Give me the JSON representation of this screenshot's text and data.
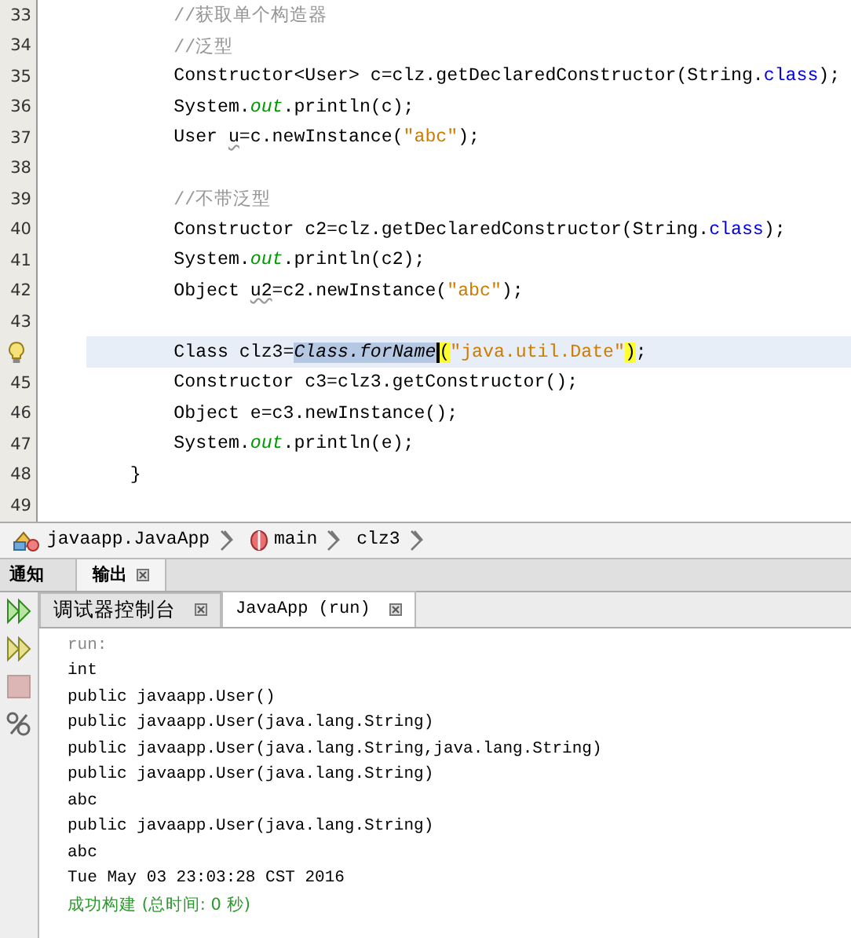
{
  "editor": {
    "lines": [
      {
        "number": "33",
        "tokens": [
          {
            "kind": "comment",
            "text": "        //获取单个构造器"
          }
        ]
      },
      {
        "number": "34",
        "tokens": [
          {
            "kind": "comment",
            "text": "        //泛型"
          }
        ]
      },
      {
        "number": "35",
        "tokens": [
          {
            "kind": "plain",
            "text": "        Constructor<User> c=clz.getDeclaredConstructor(String."
          },
          {
            "kind": "keyword",
            "text": "class"
          },
          {
            "kind": "plain",
            "text": ");"
          }
        ]
      },
      {
        "number": "36",
        "tokens": [
          {
            "kind": "plain",
            "text": "        System."
          },
          {
            "kind": "field",
            "text": "out"
          },
          {
            "kind": "plain",
            "text": ".println(c);"
          }
        ]
      },
      {
        "number": "37",
        "tokens": [
          {
            "kind": "plain",
            "text": "        User "
          },
          {
            "kind": "warning",
            "text": "u"
          },
          {
            "kind": "plain",
            "text": "=c.newInstance("
          },
          {
            "kind": "string",
            "text": "\"abc\""
          },
          {
            "kind": "plain",
            "text": ");"
          }
        ]
      },
      {
        "number": "38"
      },
      {
        "number": "39",
        "tokens": [
          {
            "kind": "comment",
            "text": "        //不带泛型"
          }
        ]
      },
      {
        "number": "40",
        "tokens": [
          {
            "kind": "plain",
            "text": "        Constructor c2=clz.getDeclaredConstructor(String."
          },
          {
            "kind": "keyword",
            "text": "class"
          },
          {
            "kind": "plain",
            "text": ");"
          }
        ]
      },
      {
        "number": "41",
        "tokens": [
          {
            "kind": "plain",
            "text": "        System."
          },
          {
            "kind": "field",
            "text": "out"
          },
          {
            "kind": "plain",
            "text": ".println(c2);"
          }
        ]
      },
      {
        "number": "42",
        "tokens": [
          {
            "kind": "plain",
            "text": "        Object "
          },
          {
            "kind": "warning",
            "text": "u2"
          },
          {
            "kind": "plain",
            "text": "=c2.newInstance("
          },
          {
            "kind": "string",
            "text": "\"abc\""
          },
          {
            "kind": "plain",
            "text": ");"
          }
        ]
      },
      {
        "number": "43"
      },
      {
        "hint": true,
        "current": true,
        "tokens": [
          {
            "kind": "plain",
            "text": "        Class clz3="
          },
          {
            "kind": "selection",
            "text": "Class.forName",
            "caret": true
          },
          {
            "kind": "bracket",
            "text": "("
          },
          {
            "kind": "string",
            "text": "\"java.util.Date\""
          },
          {
            "kind": "bracket",
            "text": ")"
          },
          {
            "kind": "plain",
            "text": ";"
          }
        ]
      },
      {
        "number": "45",
        "tokens": [
          {
            "kind": "plain",
            "text": "        Constructor c3=clz3.getConstructor();"
          }
        ]
      },
      {
        "number": "46",
        "tokens": [
          {
            "kind": "plain",
            "text": "        Object e=c3.newInstance();"
          }
        ]
      },
      {
        "number": "47",
        "tokens": [
          {
            "kind": "plain",
            "text": "        System."
          },
          {
            "kind": "field",
            "text": "out"
          },
          {
            "kind": "plain",
            "text": ".println(e);"
          }
        ]
      },
      {
        "number": "48",
        "tokens": [
          {
            "kind": "plain",
            "text": "    }"
          }
        ]
      },
      {
        "number": "49"
      }
    ]
  },
  "breadcrumb": [
    {
      "kind": "class",
      "label": "javaapp.JavaApp"
    },
    {
      "kind": "method",
      "label": "main"
    },
    {
      "kind": "variable",
      "label": "clz3"
    }
  ],
  "panel_tabs": [
    {
      "label": "通知",
      "selected": false,
      "closable": false
    },
    {
      "label": "输出",
      "selected": true,
      "closable": true
    }
  ],
  "output_tabs": [
    {
      "label": "调试器控制台",
      "selected": false,
      "closable": true
    },
    {
      "label": "JavaApp (run)",
      "selected": true,
      "closable": true
    }
  ],
  "toolbar": [
    {
      "kind": "rerun",
      "disabled": false
    },
    {
      "kind": "rerun-last",
      "disabled": false
    },
    {
      "kind": "stop",
      "disabled": true
    },
    {
      "kind": "settings",
      "disabled": false
    }
  ],
  "output": [
    {
      "kind": "muted",
      "text": "run:"
    },
    {
      "kind": "normal",
      "text": "int"
    },
    {
      "kind": "normal",
      "text": "public javaapp.User()"
    },
    {
      "kind": "normal",
      "text": "public javaapp.User(java.lang.String)"
    },
    {
      "kind": "normal",
      "text": "public javaapp.User(java.lang.String,java.lang.String)"
    },
    {
      "kind": "normal",
      "text": "public javaapp.User(java.lang.String)"
    },
    {
      "kind": "normal",
      "text": "abc"
    },
    {
      "kind": "normal",
      "text": "public javaapp.User(java.lang.String)"
    },
    {
      "kind": "normal",
      "text": "abc"
    },
    {
      "kind": "normal",
      "text": "Tue May 03 23:03:28 CST 2016"
    },
    {
      "kind": "success",
      "text": "成功构建 (总时间: 0 秒)"
    }
  ]
}
